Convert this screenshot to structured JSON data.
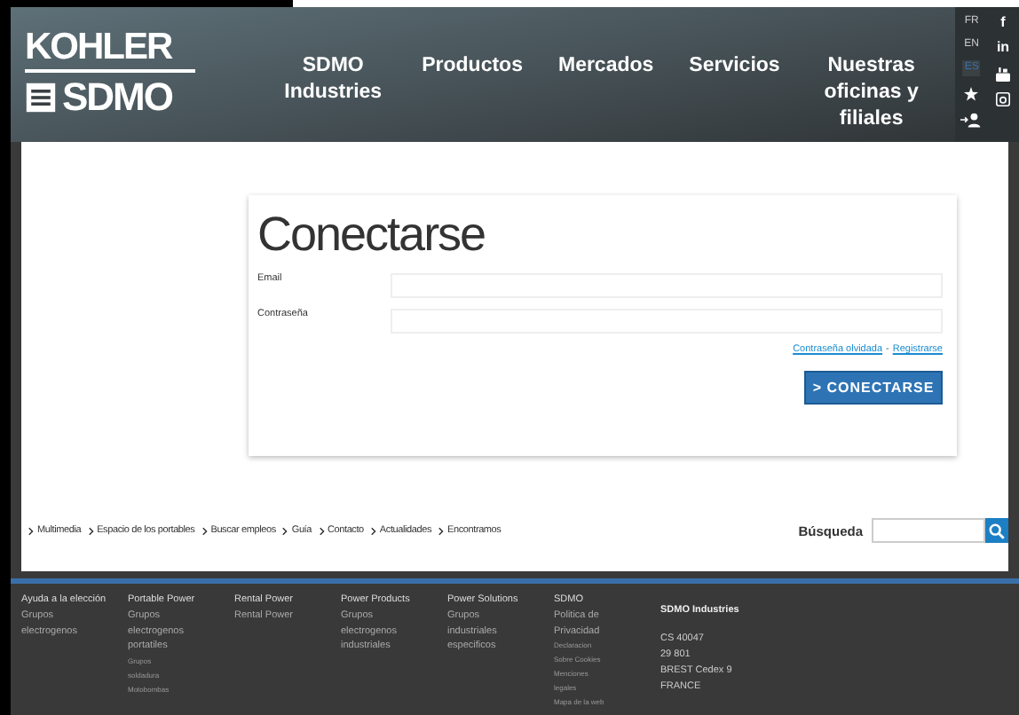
{
  "logo": {
    "top": "KOHLER",
    "bottom": "SDMO"
  },
  "nav": [
    "SDMO Industries",
    "Productos",
    "Mercados",
    "Servicios",
    "Nuestras oficinas y filiales"
  ],
  "languages": [
    {
      "label": "FR",
      "selected": false
    },
    {
      "label": "EN",
      "selected": false
    },
    {
      "label": "ES",
      "selected": true
    }
  ],
  "social": [
    "f",
    "in"
  ],
  "login": {
    "title": "Conectarse",
    "fields": [
      {
        "label": "Email"
      },
      {
        "label": "Contraseña"
      }
    ],
    "forgot": "Contraseña olvidada",
    "separator": "-",
    "register": "Registrarse",
    "button": "> CONECTARSE"
  },
  "links": [
    "Multimedia",
    "Espacio de los portables",
    "Buscar empleos",
    "Guía",
    "Contacto",
    "Actualidades",
    "Encontramos"
  ],
  "search": {
    "label": "Búsqueda"
  },
  "footer": [
    {
      "title": "Ayuda a la elección",
      "items": [
        "Grupos electrogenos"
      ]
    },
    {
      "title": "Portable Power",
      "items": [
        "Grupos electrogenos portatiles"
      ],
      "small": [
        "Grupos",
        "soldadura",
        "Motobombas"
      ]
    },
    {
      "title": "Rental Power",
      "items": [
        "Rental Power"
      ]
    },
    {
      "title": "Power Products",
      "items": [
        "Grupos electrogenos industriales"
      ]
    },
    {
      "title": "Power Solutions",
      "items": [
        "Grupos industriales especificos"
      ]
    },
    {
      "title": "SDMO",
      "items": [
        "Politica de Privacidad"
      ],
      "small": [
        "Declaracion",
        "Sobre Cookies",
        "Menciones",
        "legales",
        "Mapa de la web"
      ]
    }
  ],
  "address": {
    "title": "SDMO Industries",
    "lines": [
      "CS 40047",
      "29 801",
      "BREST Cedex 9",
      "FRANCE"
    ]
  }
}
